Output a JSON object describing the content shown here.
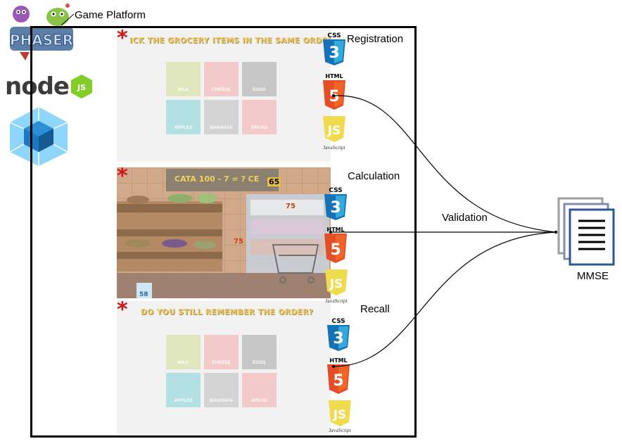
{
  "platform": {
    "label": "Game Platform"
  },
  "logos": {
    "node": "node",
    "node_js": "JS",
    "phaser": "PHASER"
  },
  "stages": [
    {
      "label": "Registration"
    },
    {
      "label": "Calculation"
    },
    {
      "label": "Recall"
    }
  ],
  "edge_label": "Validation",
  "target": {
    "label": "MMSE"
  },
  "tech": {
    "css": "CSS",
    "html": "HTML",
    "js": "JavaScript"
  },
  "screens": {
    "registration": {
      "title": "ICK THE GROCERY ITEMS IN THE SAME ORDER",
      "items": [
        "MILK",
        "CHEESE",
        "EGGS",
        "APPLES",
        "BANANAS",
        "BREAD"
      ]
    },
    "calculation": {
      "title": "CATA 100 - 7 = ? CE",
      "score_top": "65",
      "price_a": "75",
      "price_b": "75",
      "price_c": "58"
    },
    "recall": {
      "title": "DO YOU STILL REMEMBER THE ORDER?",
      "items": [
        "MILK",
        "CHEESE",
        "EGGS",
        "APPLES",
        "BANANAS",
        "BREAD"
      ]
    }
  },
  "colors": {
    "html5": "#e44d26",
    "css3": "#1572b6",
    "js": "#f0db4f",
    "webpack_light": "#8ed6fb",
    "webpack_dark": "#1c78c0",
    "node_green": "#83cd29",
    "mmse_blue": "#2b5797"
  }
}
